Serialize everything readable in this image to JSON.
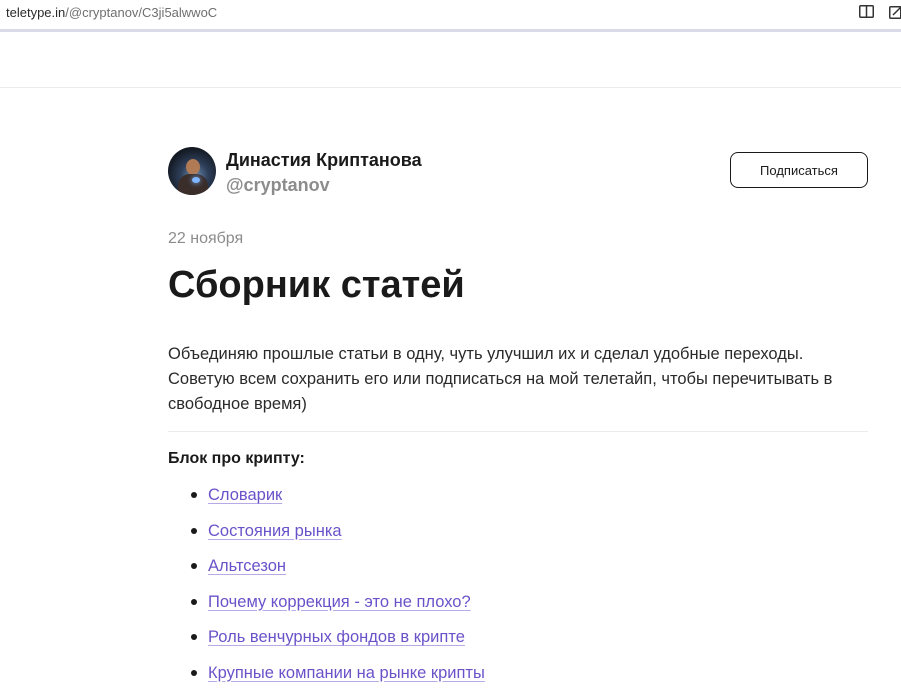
{
  "browser": {
    "url_host": "teletype.in",
    "url_path": "/@cryptanov/C3ji5alwwoC",
    "icons": [
      "reader-view-icon",
      "edit-icon"
    ]
  },
  "author": {
    "name": "Династия Криптанова",
    "handle": "@cryptanov",
    "avatar_icon": "avatar"
  },
  "subscribe_label": "Подписаться",
  "article": {
    "date": "22 ноября",
    "title": "Сборник статей",
    "intro": "Объединяю прошлые статьи в одну, чуть улучшил их и сделал удобные переходы. Советую всем сохранить его или подписаться на мой телетайп, чтобы перечитывать в свободное время)",
    "section_heading": "Блок про крипту:",
    "links": [
      "Словарик",
      "Состояния рынка",
      "Альтсезон",
      "Почему коррекция - это не плохо?",
      "Роль венчурных фондов в крипте",
      "Крупные компании на рынке крипты"
    ]
  },
  "colors": {
    "link": "#6b52c9",
    "muted": "#8c8c8c",
    "text": "#1a1a1a"
  }
}
